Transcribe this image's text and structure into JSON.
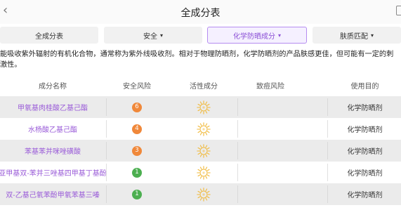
{
  "header": {
    "title": "全成分表"
  },
  "tabs": [
    {
      "label": "全成分表",
      "active": false,
      "has_caret": false
    },
    {
      "label": "安全",
      "active": false,
      "has_caret": true
    },
    {
      "label": "化学防晒成分",
      "active": true,
      "has_caret": true
    },
    {
      "label": "肤质匹配",
      "active": false,
      "has_caret": true
    }
  ],
  "caret_glyph": "▾",
  "description": "能吸收紫外辐射的有机化合物，通常称为紫外线吸收剂。相对于物理防晒剂，化学防晒剂的产品肤感更佳，但可能有一定的刺激性。",
  "columns": {
    "name": "成分名称",
    "safety": "安全风险",
    "active": "活性成分",
    "acne": "致痘风险",
    "purpose": "使用目的"
  },
  "rows": [
    {
      "name": "甲氧基肉桂酸乙基己酯",
      "safety": "6",
      "safety_color": "#f0883a",
      "active_icon": "sun-icon",
      "acne": "",
      "purpose": "化学防晒剂"
    },
    {
      "name": "水杨酸乙基己酯",
      "safety": "4",
      "safety_color": "#f0883a",
      "active_icon": "sun-icon",
      "acne": "",
      "purpose": "化学防晒剂"
    },
    {
      "name": "苯基苯并咪唑磺酸",
      "safety": "3",
      "safety_color": "#f0883a",
      "active_icon": "sun-icon",
      "acne": "",
      "purpose": "化学防晒剂"
    },
    {
      "name": "亚甲基双-苯并三唑基四甲基丁基酚",
      "safety": "1",
      "safety_color": "#4caf50",
      "active_icon": "sun-icon",
      "acne": "",
      "purpose": "化学防晒剂"
    },
    {
      "name": "双-乙基己氧苯酚甲氧苯基三嗪",
      "safety": "1",
      "safety_color": "#4caf50",
      "active_icon": "sun-icon",
      "acne": "",
      "purpose": "化学防晒剂"
    }
  ],
  "colors": {
    "accent": "#9a5cd8",
    "sun": "#f1b93a",
    "orange_badge": "#f0883a",
    "green_badge": "#4caf50"
  }
}
